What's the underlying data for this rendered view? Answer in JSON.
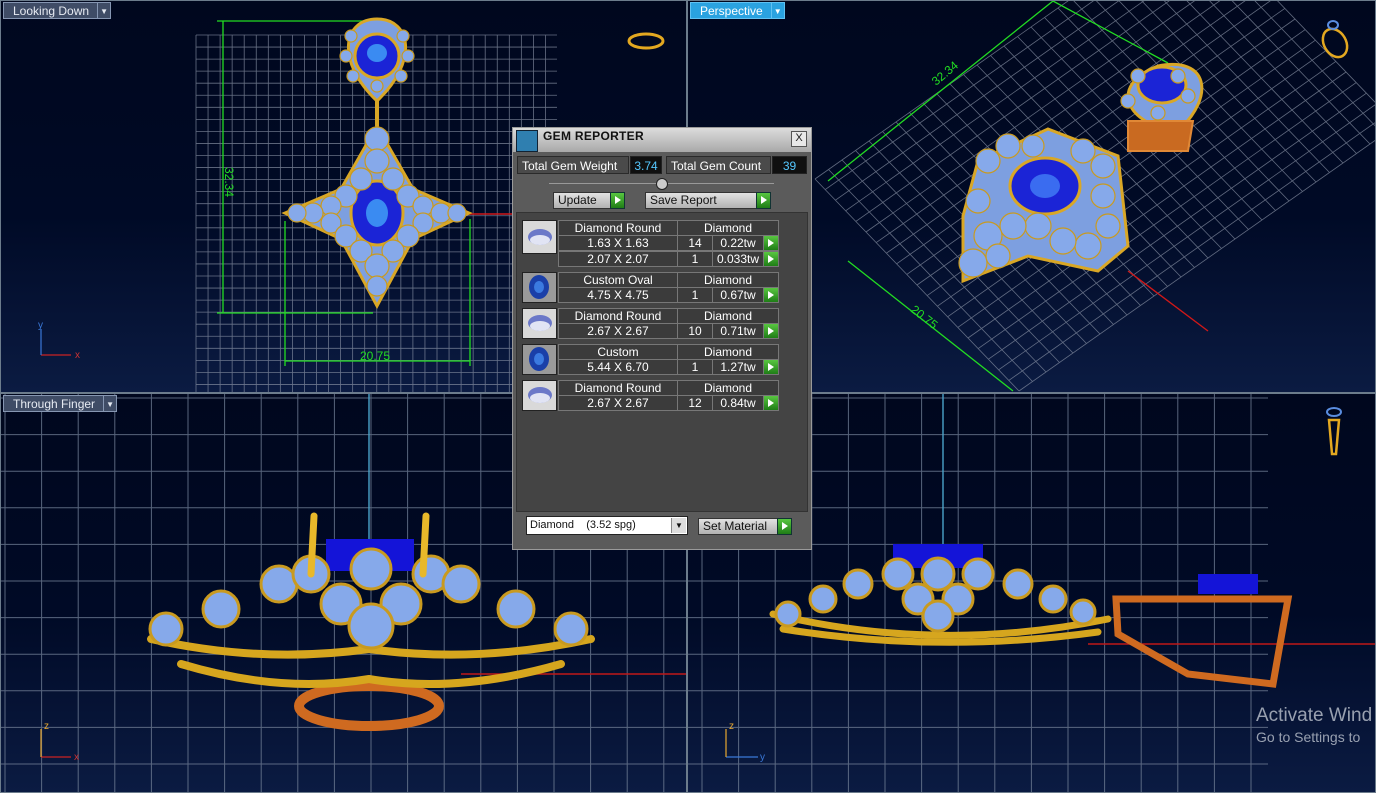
{
  "viewports": [
    {
      "label": "Looking Down",
      "active": false,
      "dims": [
        "32.34",
        "20.75"
      ],
      "axes": [
        "y",
        "x"
      ]
    },
    {
      "label": "Perspective",
      "active": true,
      "dims": [
        "32.34",
        "20.75"
      ]
    },
    {
      "label": "Through Finger",
      "active": false,
      "axes": [
        "z",
        "x"
      ]
    },
    {
      "label": "",
      "active": false,
      "axes": [
        "z",
        "y"
      ]
    }
  ],
  "watermark": {
    "line1": "Activate Wind",
    "line2": "Go to Settings to"
  },
  "gem_reporter": {
    "title": "GEM REPORTER",
    "close": "X",
    "total_weight_label": "Total Gem Weight",
    "total_weight": "3.74",
    "total_count_label": "Total Gem Count",
    "total_count": "39",
    "update_label": "Update",
    "save_label": "Save Report",
    "groups": [
      {
        "shape": "Diamond Round",
        "material": "Diamond",
        "icon": "round-diamond-icon",
        "rows": [
          {
            "size": "1.63 X 1.63",
            "qty": "14",
            "weight": "0.22tw"
          },
          {
            "size": "2.07 X 2.07",
            "qty": "1",
            "weight": "0.033tw"
          }
        ]
      },
      {
        "shape": "Custom Oval",
        "material": "Diamond",
        "icon": "oval-sapphire-icon",
        "rows": [
          {
            "size": "4.75 X 4.75",
            "qty": "1",
            "weight": "0.67tw"
          }
        ]
      },
      {
        "shape": "Diamond Round",
        "material": "Diamond",
        "icon": "round-diamond-icon",
        "rows": [
          {
            "size": "2.67 X 2.67",
            "qty": "10",
            "weight": "0.71tw"
          }
        ]
      },
      {
        "shape": "Custom",
        "material": "Diamond",
        "icon": "oval-sapphire-icon",
        "rows": [
          {
            "size": "5.44 X 6.70",
            "qty": "1",
            "weight": "1.27tw"
          }
        ]
      },
      {
        "shape": "Diamond Round",
        "material": "Diamond",
        "icon": "round-diamond-icon",
        "rows": [
          {
            "size": "2.67 X 2.67",
            "qty": "12",
            "weight": "0.84tw"
          }
        ]
      }
    ],
    "material_select": "Diamond    (3.52 spg)",
    "set_material_label": "Set Material"
  }
}
